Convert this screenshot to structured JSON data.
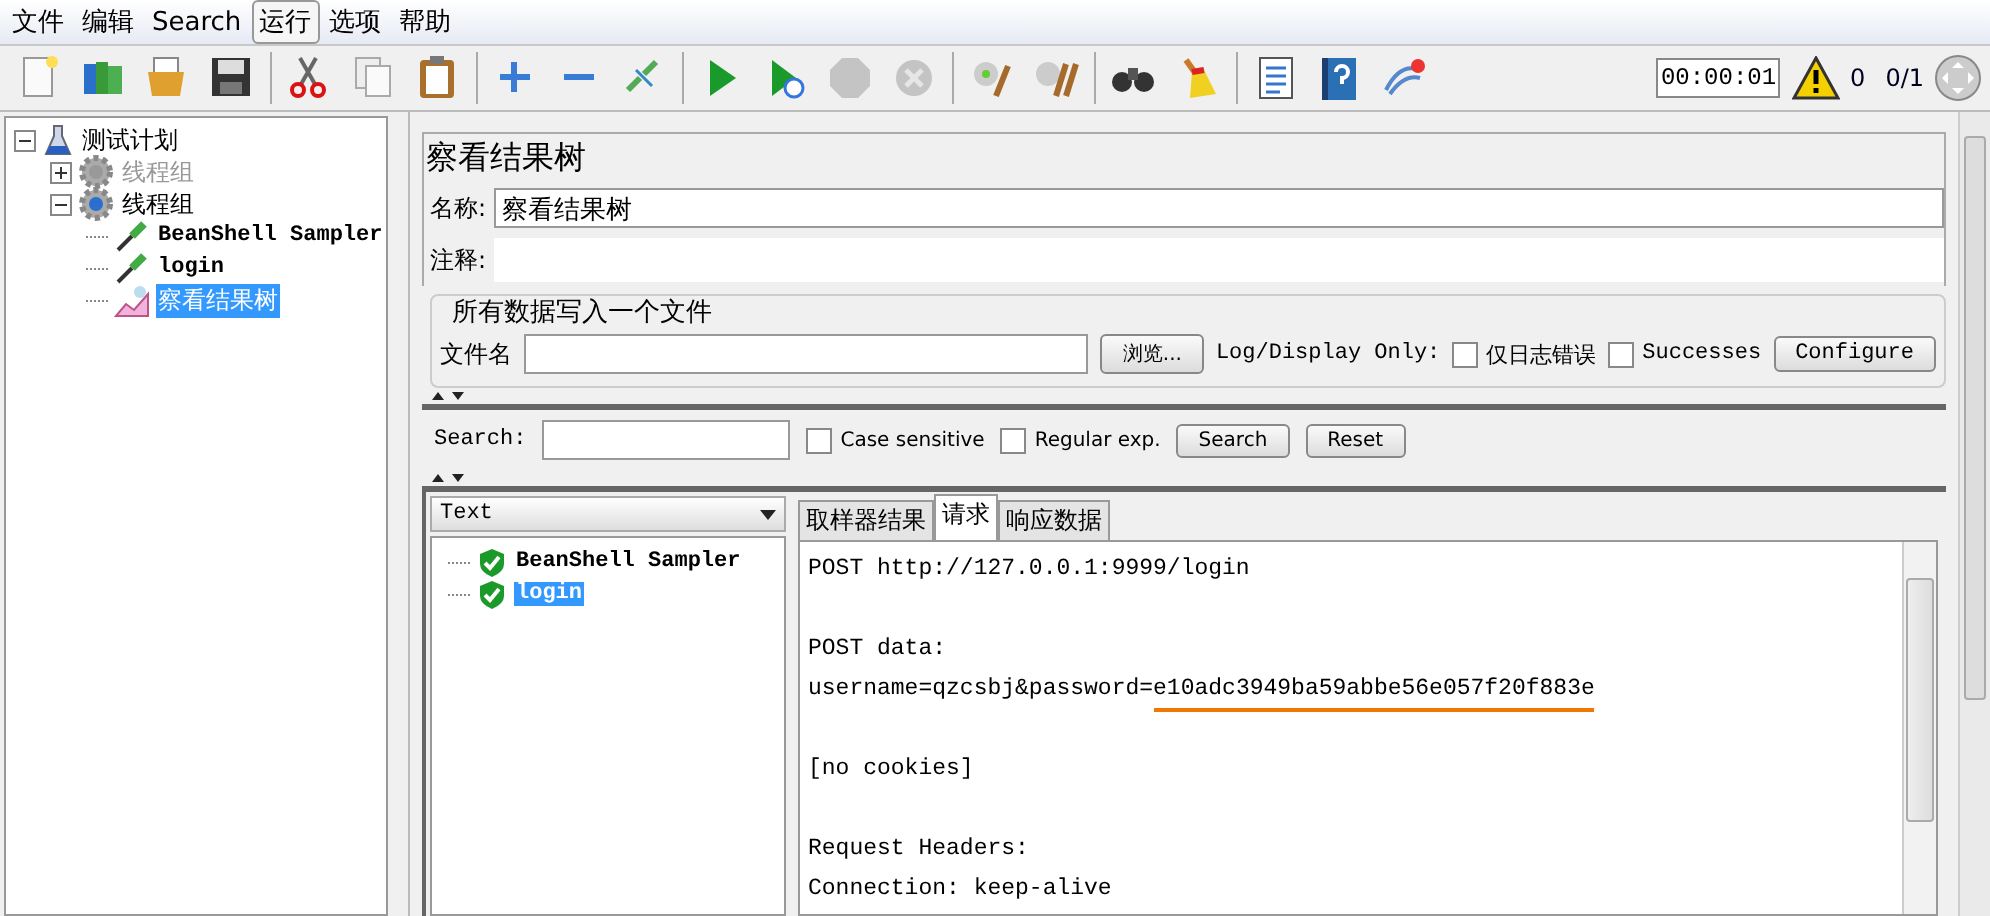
{
  "menu": [
    {
      "label": "文件",
      "selected": false
    },
    {
      "label": "编辑",
      "selected": false
    },
    {
      "label": "Search",
      "selected": false
    },
    {
      "label": "运行",
      "selected": true
    },
    {
      "label": "选项",
      "selected": false
    },
    {
      "label": "帮助",
      "selected": false
    }
  ],
  "toolbar": [
    [
      {
        "kind": "new",
        "disabled": false
      },
      {
        "kind": "templates",
        "disabled": false
      },
      {
        "kind": "open",
        "disabled": false
      },
      {
        "kind": "save",
        "disabled": false
      }
    ],
    [
      {
        "kind": "cut",
        "disabled": false
      },
      {
        "kind": "copy",
        "disabled": false
      },
      {
        "kind": "paste",
        "disabled": false
      }
    ],
    [
      {
        "kind": "expand",
        "disabled": false
      },
      {
        "kind": "collapse",
        "disabled": false
      },
      {
        "kind": "toggle",
        "disabled": false
      }
    ],
    [
      {
        "kind": "start",
        "disabled": false
      },
      {
        "kind": "start-no-timers",
        "disabled": false
      },
      {
        "kind": "stop",
        "disabled": true
      },
      {
        "kind": "shutdown",
        "disabled": true
      }
    ],
    [
      {
        "kind": "clear",
        "disabled": false
      },
      {
        "kind": "clear-all",
        "disabled": false
      }
    ],
    [
      {
        "kind": "search",
        "disabled": false
      },
      {
        "kind": "reset",
        "disabled": false
      }
    ],
    [
      {
        "kind": "functions",
        "disabled": false
      },
      {
        "kind": "help",
        "disabled": false
      },
      {
        "kind": "remote",
        "disabled": false
      }
    ]
  ],
  "status": {
    "timer": "00:00:01",
    "warnings": "0",
    "threads": "0/1"
  },
  "tree": [
    {
      "label": "测试计划",
      "kind": "plan",
      "expanded": true,
      "disabled": false,
      "selected": false,
      "children": [
        {
          "label": "线程组",
          "kind": "thread-group",
          "expanded": false,
          "disabled": true,
          "selected": false
        },
        {
          "label": "线程组",
          "kind": "thread-group",
          "expanded": true,
          "disabled": false,
          "selected": false,
          "children": [
            {
              "label": "BeanShell Sampler",
              "kind": "sampler",
              "disabled": false,
              "selected": false
            },
            {
              "label": "login",
              "kind": "sampler",
              "disabled": false,
              "selected": false
            },
            {
              "label": "察看结果树",
              "kind": "listener",
              "disabled": false,
              "selected": true
            }
          ]
        }
      ]
    }
  ],
  "panel": {
    "title": "察看结果树",
    "name_label": "名称:",
    "name_value": "察看结果树",
    "comment_label": "注释:",
    "file_group": {
      "legend": "所有数据写入一个文件",
      "file_label": "文件名",
      "browse": "浏览...",
      "log_label": "Log/Display Only:",
      "checks": [
        {
          "label": "仅日志错误",
          "checked": false
        },
        {
          "label": "Successes",
          "checked": false
        }
      ],
      "configure": "Configure"
    },
    "search": {
      "label": "Search:",
      "checks": [
        {
          "label": "Case sensitive",
          "checked": false
        },
        {
          "label": "Regular exp.",
          "checked": false
        }
      ],
      "buttons": [
        "Search",
        "Reset"
      ]
    },
    "renderer": "Text",
    "results": [
      {
        "label": "BeanShell Sampler",
        "selected": false
      },
      {
        "label": "login",
        "selected": true
      }
    ],
    "tabs": [
      {
        "label": "取样器结果",
        "selected": false
      },
      {
        "label": "请求",
        "selected": true
      },
      {
        "label": "响应数据",
        "selected": false
      }
    ],
    "request_paragraphs": [
      [
        {
          "parts": [
            {
              "text": "POST http://127.0.0.1:9999/login",
              "underlined": false
            }
          ]
        }
      ],
      [
        {
          "parts": [
            {
              "text": "POST data:",
              "underlined": false
            }
          ]
        },
        {
          "parts": [
            {
              "text": "username=qzcsbj&password=",
              "underlined": false
            },
            {
              "text": "e10adc3949ba59abbe56e057f20f883e",
              "underlined": true
            }
          ]
        }
      ],
      [
        {
          "parts": [
            {
              "text": "[no cookies]",
              "underlined": false
            }
          ]
        }
      ],
      [
        {
          "parts": [
            {
              "text": "Request Headers:",
              "underlined": false
            }
          ]
        },
        {
          "parts": [
            {
              "text": "Connection: keep-alive",
              "underlined": false
            }
          ]
        }
      ]
    ]
  }
}
